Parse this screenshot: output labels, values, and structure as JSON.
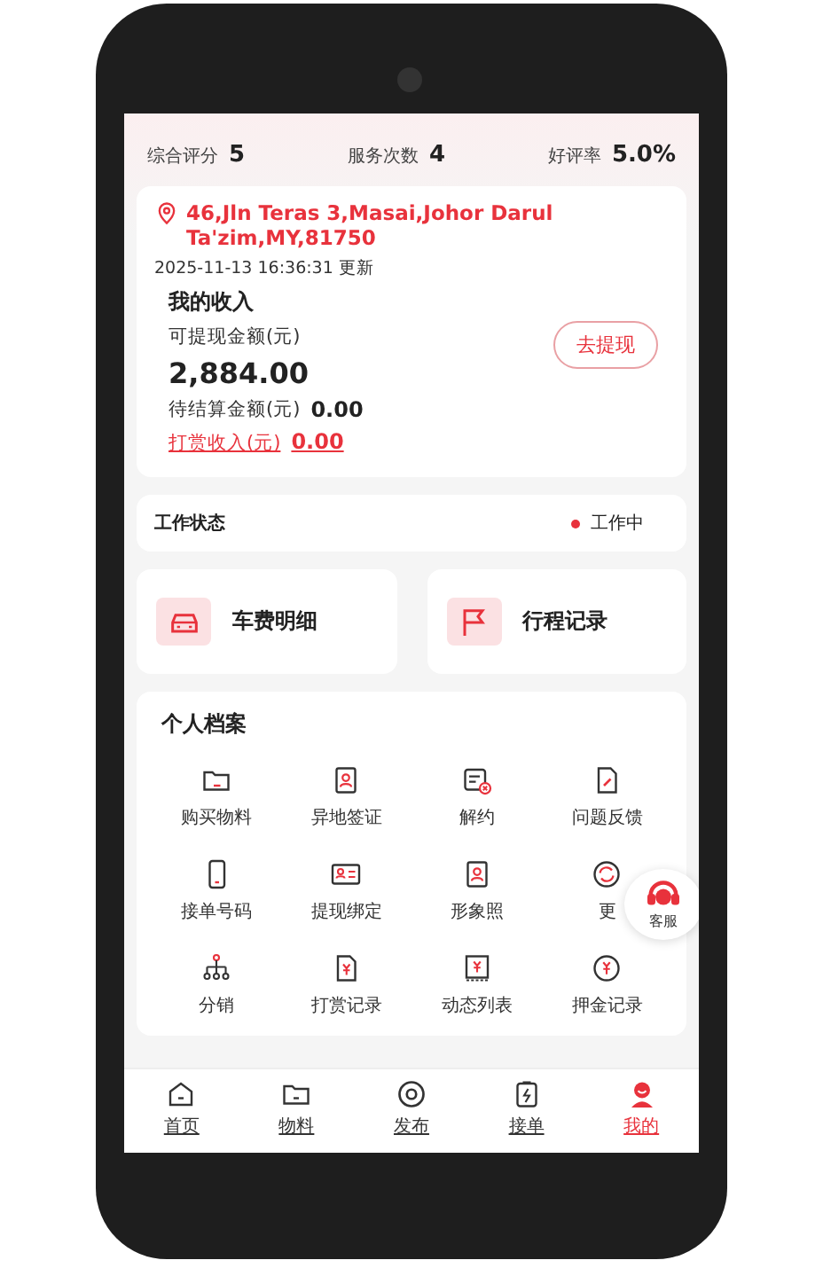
{
  "stats": [
    {
      "label": "综合评分",
      "value": "5"
    },
    {
      "label": "服务次数",
      "value": "4"
    },
    {
      "label": "好评率",
      "value": "5.0%"
    }
  ],
  "income": {
    "address": "46,Jln Teras 3,Masai,Johor Darul Ta'zim,MY,81750",
    "updated": "2025-11-13 16:36:31 更新",
    "title": "我的收入",
    "withdraw_button": "去提现",
    "available_label": "可提现金额(元)",
    "available_amount": "2,884.00",
    "pending_label": "待结算金额(元)",
    "pending_amount": "0.00",
    "tip_label": "打赏收入(元)",
    "tip_amount": "0.00"
  },
  "work_status": {
    "label": "工作状态",
    "status": "工作中"
  },
  "shortcuts": [
    {
      "label": "车费明细"
    },
    {
      "label": "行程记录"
    }
  ],
  "profile": {
    "title": "个人档案",
    "items": [
      {
        "label": "购买物料"
      },
      {
        "label": "异地签证"
      },
      {
        "label": "解约"
      },
      {
        "label": "问题反馈"
      },
      {
        "label": "接单号码"
      },
      {
        "label": "提现绑定"
      },
      {
        "label": "形象照"
      },
      {
        "label": "更"
      },
      {
        "label": "分销"
      },
      {
        "label": "打赏记录"
      },
      {
        "label": "动态列表"
      },
      {
        "label": "押金记录"
      }
    ]
  },
  "support_button": {
    "label": "客服"
  },
  "nav": [
    {
      "label": "首页",
      "selected": false
    },
    {
      "label": "物料",
      "selected": false
    },
    {
      "label": "发布",
      "selected": false
    },
    {
      "label": "接单",
      "selected": false
    },
    {
      "label": "我的",
      "selected": true
    }
  ]
}
